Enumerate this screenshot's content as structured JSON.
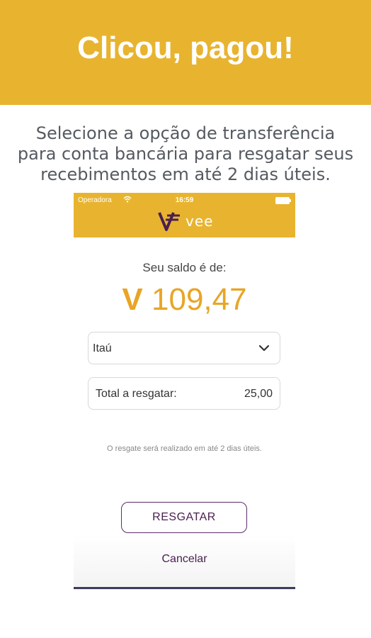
{
  "banner": {
    "title": "Clicou, pagou!"
  },
  "subtitle": {
    "lines": [
      "Selecione a opção de transferência",
      "para conta bancária para resgatar seus",
      "recebimentos em até 2 dias úteis."
    ]
  },
  "status_bar": {
    "carrier": "Operadora",
    "time": "16:59"
  },
  "app": {
    "logo_text": "vee",
    "balance_label": "Seu saldo é de:",
    "currency_symbol": "V",
    "balance_value": "109,47",
    "bank_select": {
      "selected": "Itaú"
    },
    "total": {
      "label": "Total a resgatar:",
      "value": "25,00"
    },
    "notice": "O resgate será realizado em até 2 dias úteis.",
    "primary_button": "RESGATAR",
    "cancel_link": "Cancelar"
  },
  "colors": {
    "brand_yellow": "#E8B42F",
    "amount_orange": "#E8A526",
    "brand_purple": "#4a2050"
  }
}
